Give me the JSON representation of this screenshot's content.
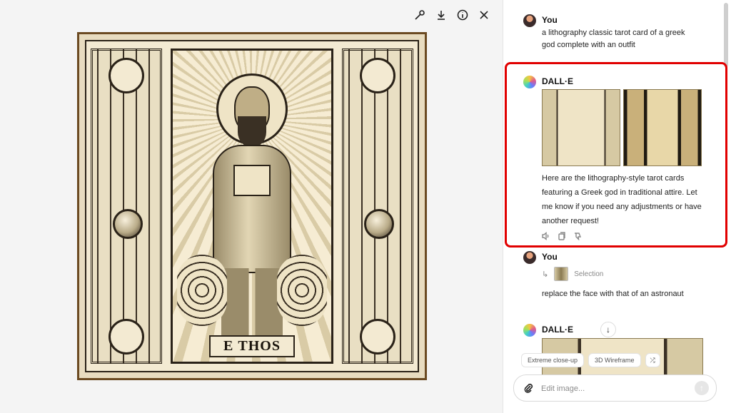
{
  "viewer": {
    "toolbar": {
      "icons": [
        "edit-brush-icon",
        "download-icon",
        "info-icon",
        "close-icon"
      ]
    },
    "image": {
      "label": "Ε THOS"
    }
  },
  "chat": {
    "messages": [
      {
        "author": "You",
        "text": "a lithography classic tarot card of a greek god complete with an outfit"
      },
      {
        "author": "DALL·E",
        "text": "Here are the lithography-style tarot cards featuring a Greek god in traditional attire. Let me know if you need any adjustments or have another request!",
        "highlighted": true
      },
      {
        "author": "You",
        "selection_label": "Selection",
        "text": "replace the face with that of an astronaut"
      },
      {
        "author": "DALL·E"
      }
    ],
    "chips": [
      "Extreme close-up",
      "3D Wireframe"
    ],
    "composer": {
      "placeholder": "Edit image..."
    }
  },
  "colors": {
    "highlight": "#e10000",
    "text": "#0d0d0d",
    "muted": "#888888"
  }
}
